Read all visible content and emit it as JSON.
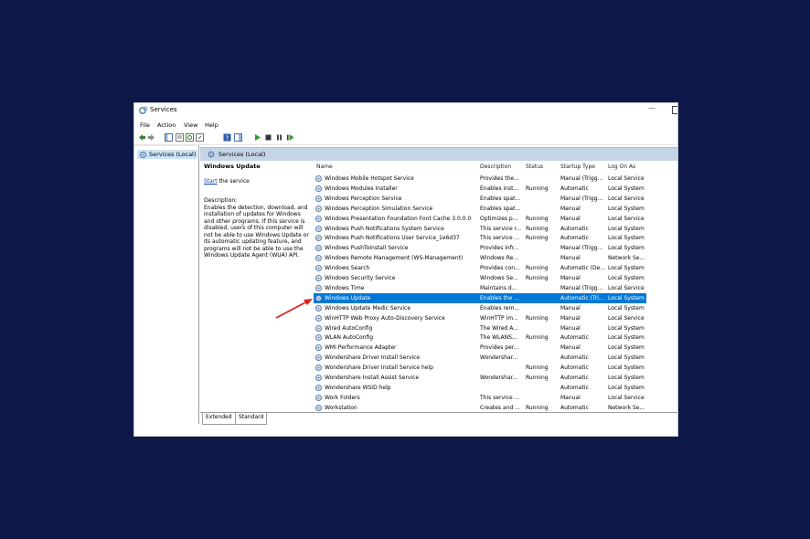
{
  "window": {
    "title": "Services"
  },
  "menu": [
    "File",
    "Action",
    "View",
    "Help"
  ],
  "left_pane": {
    "item": "Services (Local)"
  },
  "right_pane": {
    "header": "Services (Local)"
  },
  "description": {
    "service_name": "Windows Update",
    "start_link": "Start",
    "start_suffix": " the service",
    "label": "Description:",
    "text": "Enables the detection, download, and installation of updates for Windows and other programs. If this service is disabled, users of this computer will not be able to use Windows Update or its automatic updating feature, and programs will not be able to use the Windows Update Agent (WUA) API."
  },
  "columns": {
    "name": "Name",
    "description": "Description",
    "status": "Status",
    "startup": "Startup Type",
    "logon": "Log On As"
  },
  "services": [
    {
      "name": "Windows Mobile Hotspot Service",
      "desc": "Provides the...",
      "status": "",
      "startup": "Manual (Trigg...",
      "logon": "Local Service"
    },
    {
      "name": "Windows Modules Installer",
      "desc": "Enables inst...",
      "status": "Running",
      "startup": "Automatic",
      "logon": "Local System"
    },
    {
      "name": "Windows Perception Service",
      "desc": "Enables spat...",
      "status": "",
      "startup": "Manual (Trigg...",
      "logon": "Local Service"
    },
    {
      "name": "Windows Perception Simulation Service",
      "desc": "Enables spat...",
      "status": "",
      "startup": "Manual",
      "logon": "Local System"
    },
    {
      "name": "Windows Presentation Foundation Font Cache 3.0.0.0",
      "desc": "Optimizes p...",
      "status": "Running",
      "startup": "Manual",
      "logon": "Local Service"
    },
    {
      "name": "Windows Push Notifications System Service",
      "desc": "This service r...",
      "status": "Running",
      "startup": "Automatic",
      "logon": "Local System"
    },
    {
      "name": "Windows Push Notifications User Service_1e6d37",
      "desc": "This service ...",
      "status": "Running",
      "startup": "Automatic",
      "logon": "Local System"
    },
    {
      "name": "Windows PushToInstall Service",
      "desc": "Provides infr...",
      "status": "",
      "startup": "Manual (Trigg...",
      "logon": "Local System"
    },
    {
      "name": "Windows Remote Management (WS-Management)",
      "desc": "Windows Re...",
      "status": "",
      "startup": "Manual",
      "logon": "Network Se..."
    },
    {
      "name": "Windows Search",
      "desc": "Provides con...",
      "status": "Running",
      "startup": "Automatic (De...",
      "logon": "Local System"
    },
    {
      "name": "Windows Security Service",
      "desc": "Windows Se...",
      "status": "Running",
      "startup": "Manual",
      "logon": "Local System"
    },
    {
      "name": "Windows Time",
      "desc": "Maintains d...",
      "status": "",
      "startup": "Manual (Trigg...",
      "logon": "Local Service"
    },
    {
      "name": "Windows Update",
      "desc": "Enables the ...",
      "status": "",
      "startup": "Automatic (Tri...",
      "logon": "Local System"
    },
    {
      "name": "Windows Update Medic Service",
      "desc": "Enables rem...",
      "status": "",
      "startup": "Manual",
      "logon": "Local System"
    },
    {
      "name": "WinHTTP Web Proxy Auto-Discovery Service",
      "desc": "WinHTTP im...",
      "status": "Running",
      "startup": "Manual",
      "logon": "Local Service"
    },
    {
      "name": "Wired AutoConfig",
      "desc": "The Wired A...",
      "status": "",
      "startup": "Manual",
      "logon": "Local System"
    },
    {
      "name": "WLAN AutoConfig",
      "desc": "The WLANS...",
      "status": "Running",
      "startup": "Automatic",
      "logon": "Local System"
    },
    {
      "name": "WMI Performance Adapter",
      "desc": "Provides per...",
      "status": "",
      "startup": "Manual",
      "logon": "Local System"
    },
    {
      "name": "Wondershare Driver Install Service",
      "desc": "Wondershar...",
      "status": "",
      "startup": "Automatic",
      "logon": "Local System"
    },
    {
      "name": "Wondershare Driver Install Service help",
      "desc": "",
      "status": "Running",
      "startup": "Automatic",
      "logon": "Local System"
    },
    {
      "name": "Wondershare Install Assist Service",
      "desc": "Wondershar...",
      "status": "Running",
      "startup": "Automatic",
      "logon": "Local System"
    },
    {
      "name": "Wondershare WSID help",
      "desc": "",
      "status": "",
      "startup": "Automatic",
      "logon": "Local System"
    },
    {
      "name": "Work Folders",
      "desc": "This service ...",
      "status": "",
      "startup": "Manual",
      "logon": "Local Service"
    },
    {
      "name": "Workstation",
      "desc": "Creates and ...",
      "status": "Running",
      "startup": "Automatic",
      "logon": "Network Se..."
    }
  ],
  "selected_index": 12,
  "tabs": [
    "Extended",
    "Standard"
  ],
  "colors": {
    "selection": "#0078d7",
    "background": "#0d1748",
    "arrow": "#d9221c"
  }
}
